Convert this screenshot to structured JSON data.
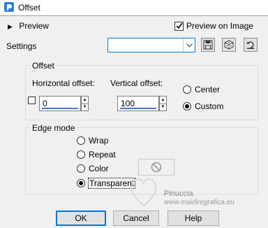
{
  "window": {
    "title": "Offset"
  },
  "header": {
    "preview_toggle": "Preview",
    "preview_on_image": "Preview on Image",
    "preview_on_image_checked": true
  },
  "settings": {
    "label": "Settings",
    "value": ""
  },
  "offset_group": {
    "label": "Offset",
    "horizontal": {
      "label": "Horizontal offset:",
      "value": "0"
    },
    "vertical": {
      "label": "Vertical offset:",
      "value": "100"
    },
    "modes": [
      {
        "label": "Center",
        "selected": false
      },
      {
        "label": "Custom",
        "selected": true
      }
    ]
  },
  "edge_mode": {
    "label": "Edge mode",
    "options": [
      {
        "label": "Wrap",
        "selected": false
      },
      {
        "label": "Repeat",
        "selected": false
      },
      {
        "label": "Color",
        "selected": false
      },
      {
        "label": "Transparent",
        "selected": true
      }
    ]
  },
  "buttons": {
    "ok": "OK",
    "cancel": "Cancel",
    "help": "Help"
  },
  "watermark": {
    "line1": "Pinuccia",
    "line2": "www.maidiregrafica.eu"
  },
  "colors": {
    "accent": "#0078d7",
    "spin_underline": "#3a78d6"
  }
}
